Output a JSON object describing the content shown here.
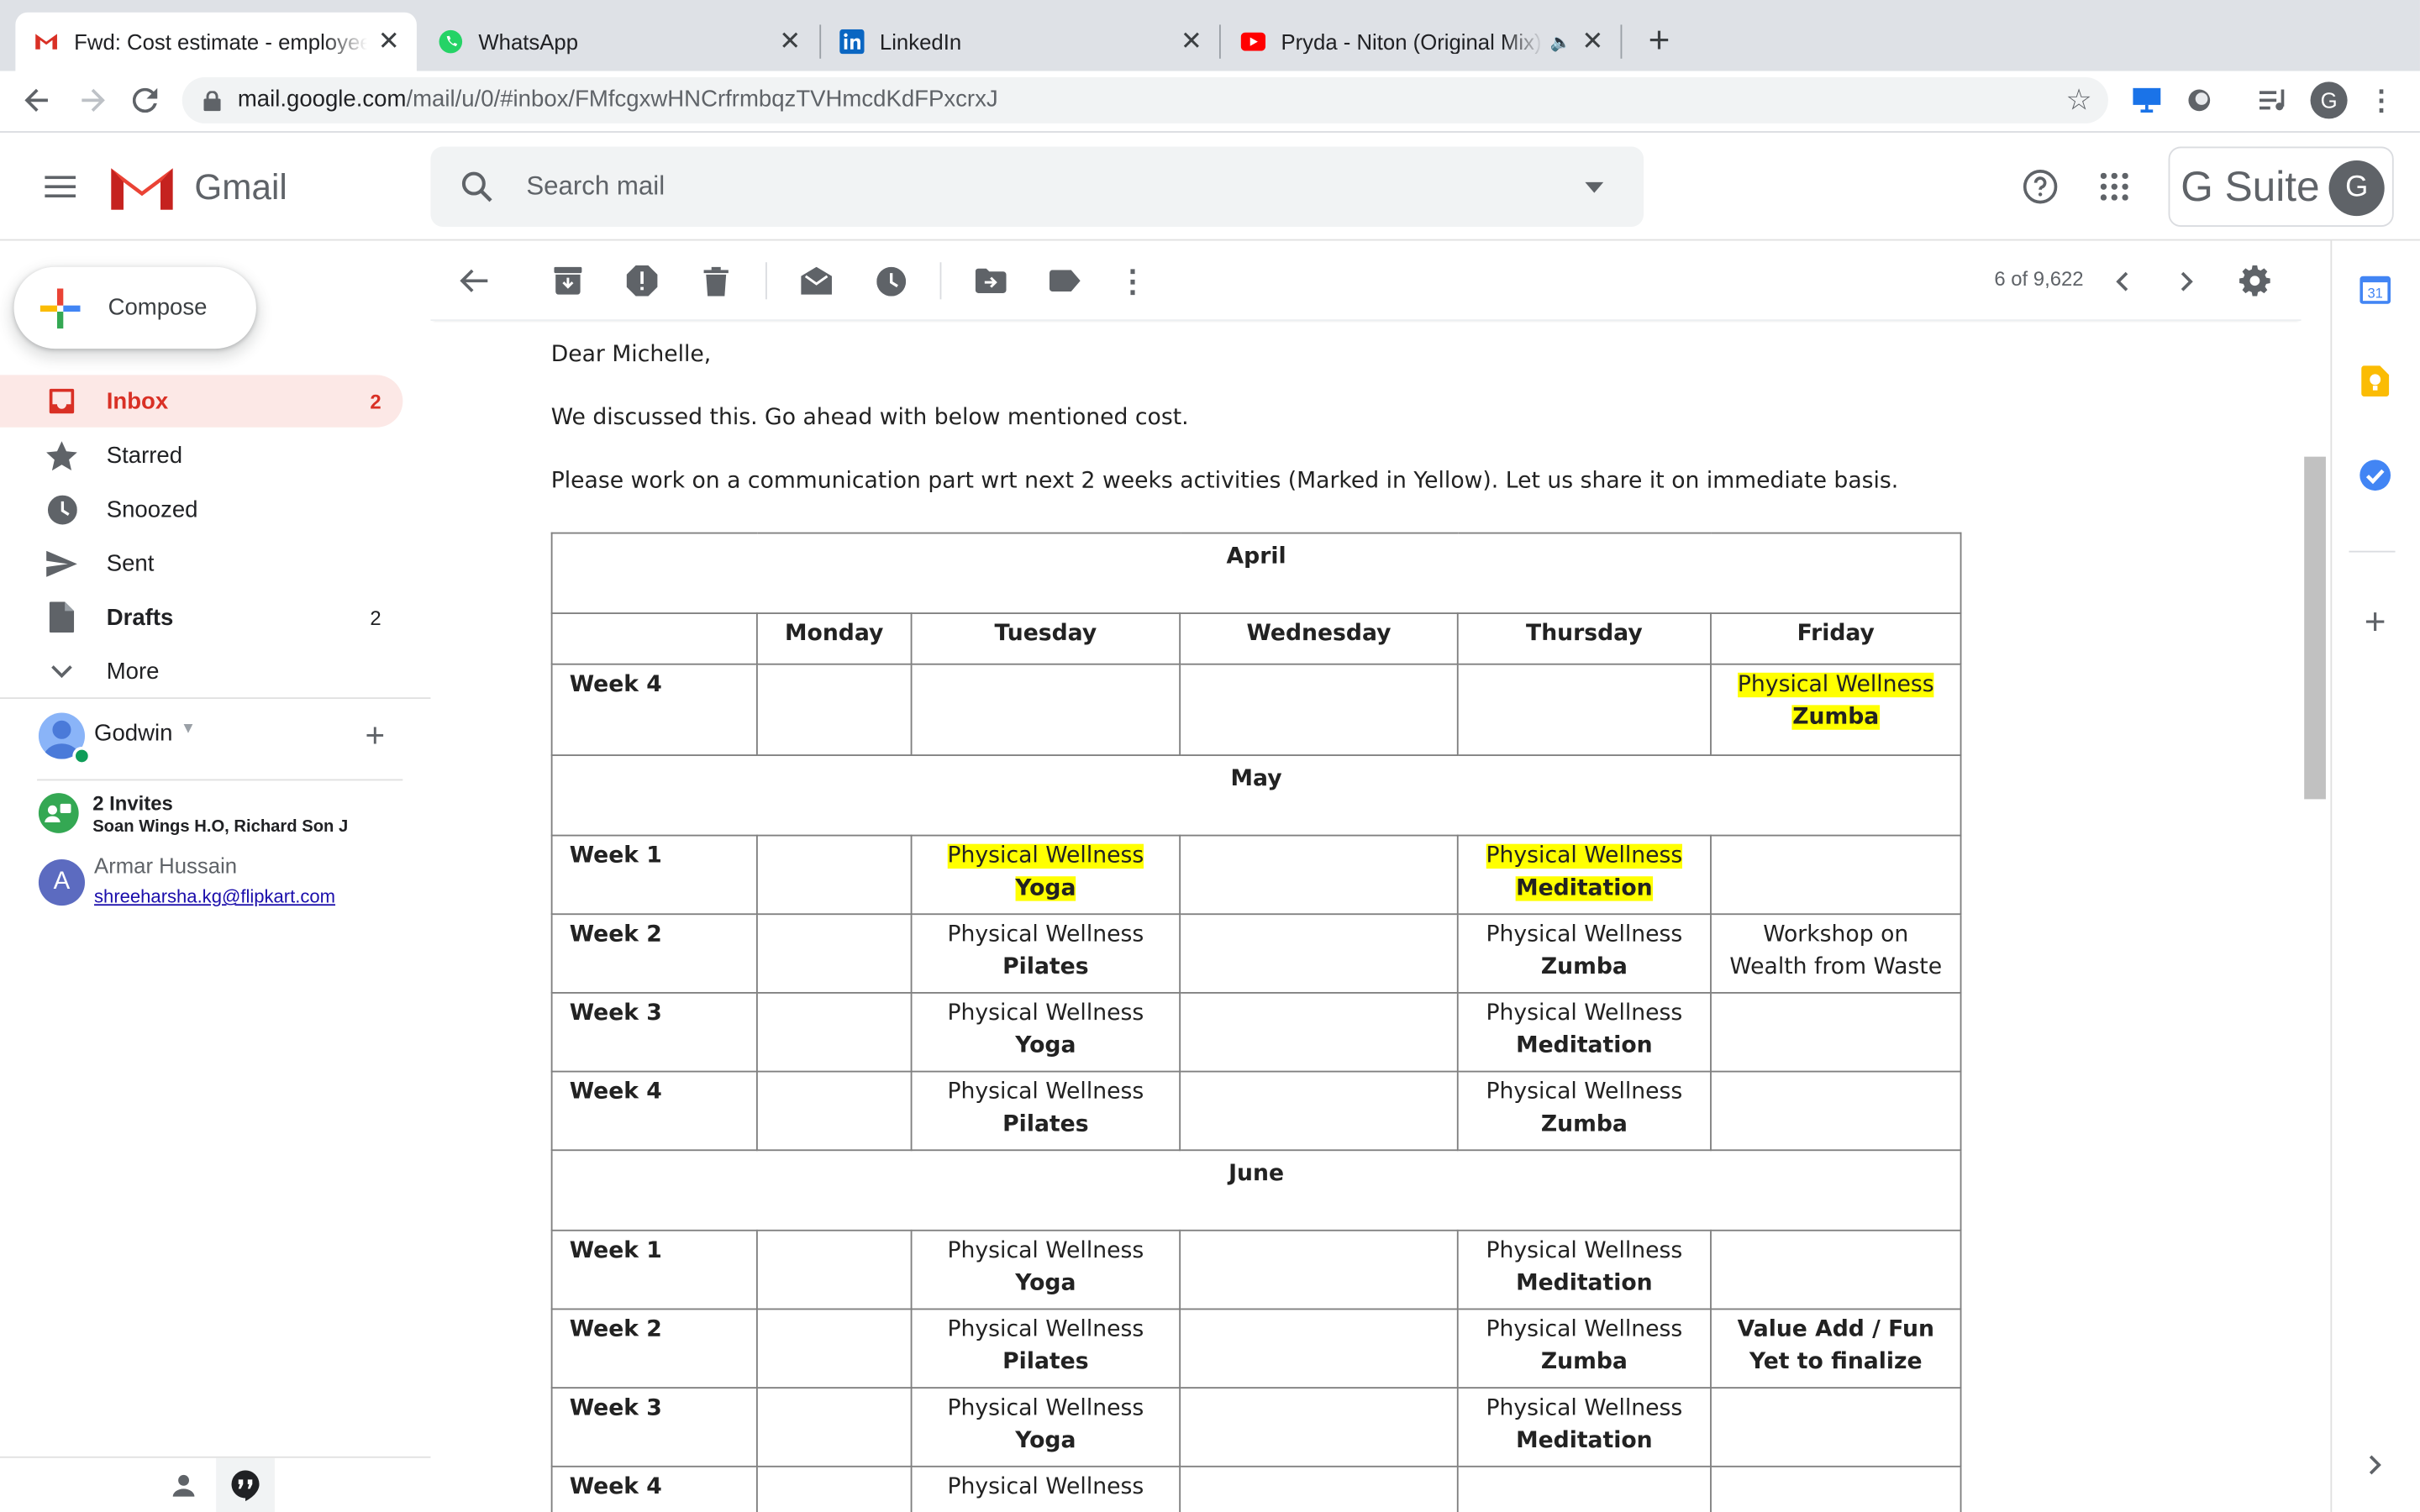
{
  "browser": {
    "tabs": [
      {
        "title": "Fwd: Cost estimate - employee",
        "icon": "gmail-icon"
      },
      {
        "title": "WhatsApp",
        "icon": "whatsapp-icon"
      },
      {
        "title": "LinkedIn",
        "icon": "linkedin-icon"
      },
      {
        "title": "Pryda - Niton (Original Mix)",
        "icon": "youtube-icon"
      }
    ],
    "url_domain": "mail.google.com",
    "url_path": "/mail/u/0/#inbox/FMfcgxwHNCrfrmbqzTVHmcdKdFPxcrxJ",
    "profile_initial": "G"
  },
  "gmail": {
    "brand": "Gmail",
    "search_placeholder": "Search mail",
    "gsuite_label": "G Suite",
    "account_initial": "G",
    "compose_label": "Compose",
    "nav": [
      {
        "label": "Inbox",
        "count": "2",
        "icon": "inbox-icon"
      },
      {
        "label": "Starred",
        "count": "",
        "icon": "star-icon"
      },
      {
        "label": "Snoozed",
        "count": "",
        "icon": "clock-icon"
      },
      {
        "label": "Sent",
        "count": "",
        "icon": "send-icon"
      },
      {
        "label": "Drafts",
        "count": "2",
        "icon": "draft-icon"
      },
      {
        "label": "More",
        "count": "",
        "icon": "chevron-down-icon"
      }
    ],
    "hangouts": {
      "user": "Godwin",
      "invites_title": "2 Invites",
      "invites_names": "Soan Wings H.O, Richard Son J",
      "contact_name": "Armar Hussain",
      "contact_initial": "A",
      "contact_email": "shreeharsha.kg@flipkart.com"
    },
    "pager": "6 of 9,622"
  },
  "email": {
    "greeting": "Dear Michelle,",
    "line1": "We discussed this. Go ahead with below mentioned cost.",
    "line2": "Please work on a communication part wrt next 2 weeks activities (Marked in Yellow). Let us share it on immediate basis.",
    "days": [
      "Monday",
      "Tuesday",
      "Wednesday",
      "Thursday",
      "Friday"
    ],
    "months": [
      "April",
      "May",
      "June"
    ],
    "highlight_color": "#ffff00",
    "rows": {
      "apr_w4": {
        "week": "Week 4",
        "fri_a": "Physical Wellness",
        "fri_b": "Zumba"
      },
      "may_w1": {
        "week": "Week 1",
        "tue_a": "Physical Wellness",
        "tue_b": "Yoga",
        "thu_a": "Physical Wellness",
        "thu_b": "Meditation"
      },
      "may_w2": {
        "week": "Week 2",
        "tue_a": "Physical Wellness",
        "tue_b": "Pilates",
        "thu_a": "Physical Wellness",
        "thu_b": "Zumba",
        "fri_a": "Workshop on",
        "fri_b": "Wealth from Waste"
      },
      "may_w3": {
        "week": "Week 3",
        "tue_a": "Physical Wellness",
        "tue_b": "Yoga",
        "thu_a": "Physical Wellness",
        "thu_b": "Meditation"
      },
      "may_w4": {
        "week": "Week 4",
        "tue_a": "Physical Wellness",
        "tue_b": "Pilates",
        "thu_a": "Physical Wellness",
        "thu_b": "Zumba"
      },
      "jun_w1": {
        "week": "Week 1",
        "tue_a": "Physical Wellness",
        "tue_b": "Yoga",
        "thu_a": "Physical Wellness",
        "thu_b": "Meditation"
      },
      "jun_w2": {
        "week": "Week 2",
        "tue_a": "Physical Wellness",
        "tue_b": "Pilates",
        "thu_a": "Physical Wellness",
        "thu_b": "Zumba",
        "fri_a": "Value Add / Fun",
        "fri_b": "Yet to finalize"
      },
      "jun_w3": {
        "week": "Week 3",
        "tue_a": "Physical Wellness",
        "tue_b": "Yoga",
        "thu_a": "Physical Wellness",
        "thu_b": "Meditation"
      },
      "jun_w4": {
        "week": "Week 4",
        "tue_a": "Physical Wellness"
      }
    }
  }
}
